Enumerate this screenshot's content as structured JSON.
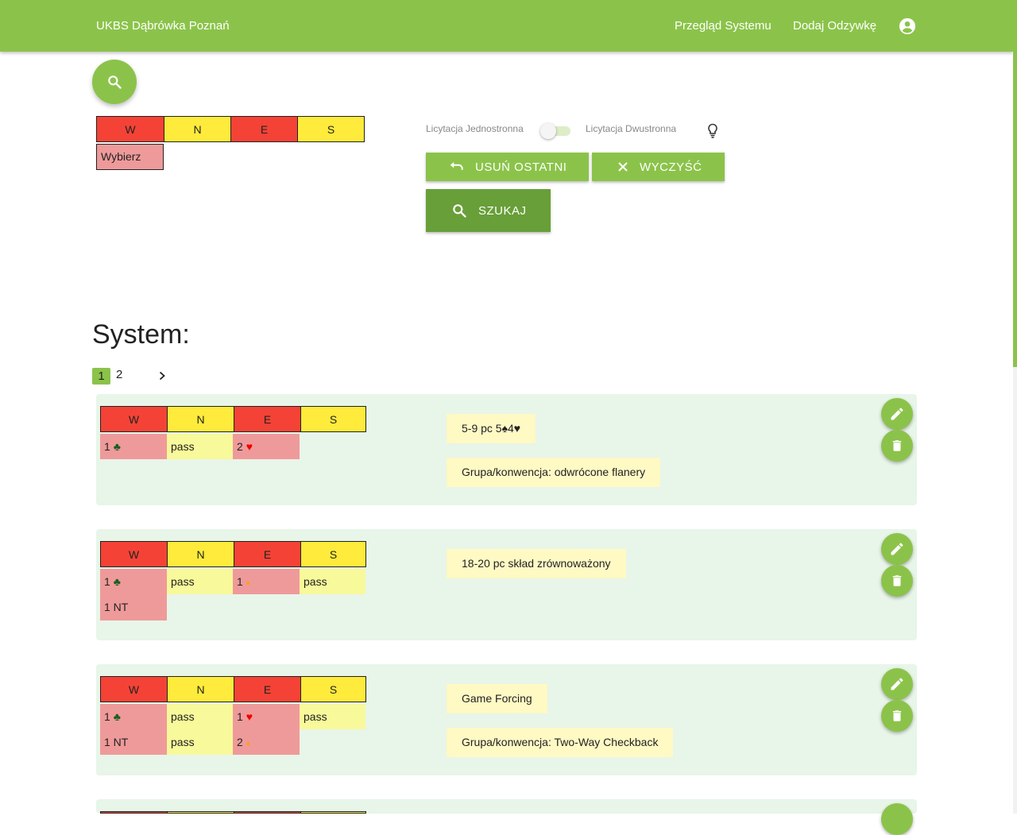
{
  "appbar": {
    "title": "UKBS Dąbrówka Poznań",
    "nav": [
      "Przegląd Systemu",
      "Dodaj Odzywkę"
    ],
    "account_icon": "account-circle-icon"
  },
  "bidding_box": {
    "headers": [
      "W",
      "N",
      "E",
      "S"
    ],
    "select_label": "Wybierz"
  },
  "controls": {
    "toggle_left": "Licytacja Jednostronna",
    "toggle_right": "Licytacja Dwustronna",
    "undo_label": "USUŃ OSTATNI",
    "clear_label": "WYCZYŚĆ",
    "search_label": "SZUKAJ"
  },
  "system": {
    "title": "System:",
    "pages": [
      "1",
      "2"
    ],
    "next_icon": "chevron-right-icon"
  },
  "cards": [
    {
      "rows": [
        [
          "1 ♣",
          "pass",
          "2 ♥",
          ""
        ]
      ],
      "notes": [
        "5-9 pc 5♠4♥",
        "Grupa/konwencja: odwrócone flanery"
      ]
    },
    {
      "rows": [
        [
          "1 ♣",
          "pass",
          "1 ♦",
          "pass"
        ],
        [
          "1 NT",
          "",
          "",
          ""
        ]
      ],
      "notes": [
        "18-20 pc skład zrównoważony"
      ]
    },
    {
      "rows": [
        [
          "1 ♣",
          "pass",
          "1 ♥",
          "pass"
        ],
        [
          "1 NT",
          "pass",
          "2 ♦",
          ""
        ]
      ],
      "notes": [
        "Game Forcing",
        "Grupa/konwencja: Two-Way Checkback"
      ]
    }
  ],
  "colors": {
    "primary": "#8bc34a",
    "primary_dark": "#689f38",
    "red_seat": "#f44336",
    "yellow_seat": "#ffeb3b",
    "card_bg": "#e8f5e9",
    "note_bg": "#fff9c4"
  }
}
